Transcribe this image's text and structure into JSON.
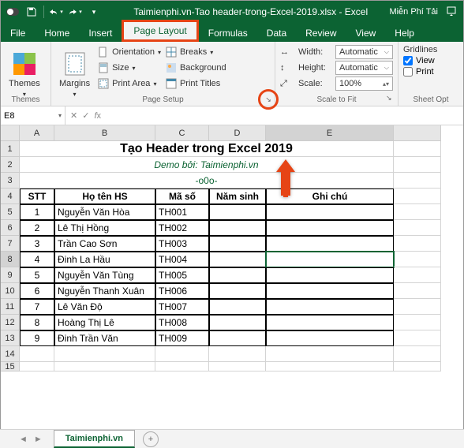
{
  "titlebar": {
    "filename": "Taimienphi.vn-Tao header-trong-Excel-2019.xlsx - Excel",
    "right_text": "Miễn Phí Tải"
  },
  "tabs": [
    "File",
    "Home",
    "Insert",
    "Page Layout",
    "Formulas",
    "Data",
    "Review",
    "View",
    "Help"
  ],
  "ribbon": {
    "themes": {
      "label": "Themes",
      "group": "Themes"
    },
    "pagesetup": {
      "margins": "Margins",
      "orientation": "Orientation",
      "size": "Size",
      "printarea": "Print Area",
      "breaks": "Breaks",
      "background": "Background",
      "printtitles": "Print Titles",
      "group": "Page Setup"
    },
    "scaletofit": {
      "width_lbl": "Width:",
      "width_val": "Automatic",
      "height_lbl": "Height:",
      "height_val": "Automatic",
      "scale_lbl": "Scale:",
      "scale_val": "100%",
      "group": "Scale to Fit"
    },
    "sheetopt": {
      "gridlines": "Gridlines",
      "view": "View",
      "print": "Print",
      "group": "Sheet Opt"
    }
  },
  "namebox": "E8",
  "cols": [
    "A",
    "B",
    "C",
    "D",
    "E"
  ],
  "sheet": {
    "title": "Tạo Header trong Excel 2019",
    "demo": "Demo bởi: Taimienphi.vn",
    "sep": "-o0o-",
    "headers": {
      "stt": "STT",
      "hoten": "Họ tên HS",
      "maso": "Mã số",
      "namsinh": "Năm sinh",
      "ghichu": "Ghi chú"
    },
    "rows": [
      {
        "stt": "1",
        "hoten": "Nguyễn Văn Hòa",
        "maso": "TH001"
      },
      {
        "stt": "2",
        "hoten": "Lê Thị Hồng",
        "maso": "TH002"
      },
      {
        "stt": "3",
        "hoten": "Trần Cao Sơn",
        "maso": "TH003"
      },
      {
        "stt": "4",
        "hoten": "Đinh La Hầu",
        "maso": "TH004"
      },
      {
        "stt": "5",
        "hoten": "Nguyễn Văn Tùng",
        "maso": "TH005"
      },
      {
        "stt": "6",
        "hoten": "Nguyễn Thanh Xuân",
        "maso": "TH006"
      },
      {
        "stt": "7",
        "hoten": "Lê Văn Độ",
        "maso": "TH007"
      },
      {
        "stt": "8",
        "hoten": "Hoàng Thị Lê",
        "maso": "TH008"
      },
      {
        "stt": "9",
        "hoten": "Đinh Trần Văn",
        "maso": "TH009"
      }
    ]
  },
  "sheettab": "Taimienphi.vn"
}
